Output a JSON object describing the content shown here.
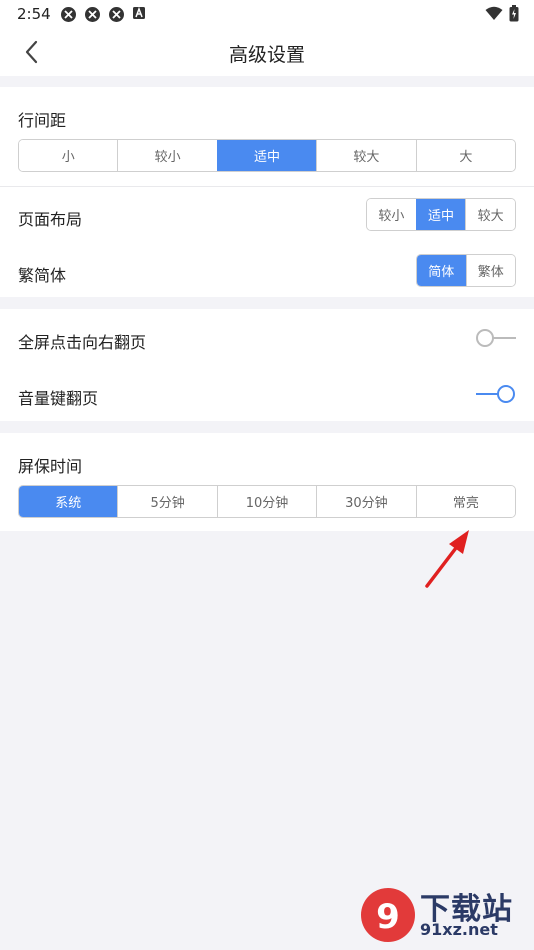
{
  "status": {
    "time": "2:54",
    "icons": [
      "app-notify-icon",
      "app-notify-icon",
      "app-notify-icon",
      "a-box-icon"
    ],
    "right_icons": [
      "wifi-icon",
      "battery-icon"
    ]
  },
  "header": {
    "title": "高级设置"
  },
  "line_spacing": {
    "label": "行间距",
    "options": [
      "小",
      "较小",
      "适中",
      "较大",
      "大"
    ],
    "selected": "适中"
  },
  "page_layout": {
    "label": "页面布局",
    "options": [
      "较小",
      "适中",
      "较大"
    ],
    "selected": "适中"
  },
  "script": {
    "label": "繁简体",
    "options": [
      "简体",
      "繁体"
    ],
    "selected": "简体"
  },
  "toggles": {
    "fullscreen_tap": {
      "label": "全屏点击向右翻页",
      "on": false
    },
    "volume_key": {
      "label": "音量键翻页",
      "on": true
    }
  },
  "screensaver": {
    "label": "屏保时间",
    "options": [
      "系统",
      "5分钟",
      "10分钟",
      "30分钟",
      "常亮"
    ],
    "selected": "系统"
  },
  "watermark": {
    "line1": "下载站",
    "line2": "91xz.net"
  },
  "colors": {
    "accent": "#4a8af0",
    "annotation_arrow": "#e02020"
  }
}
